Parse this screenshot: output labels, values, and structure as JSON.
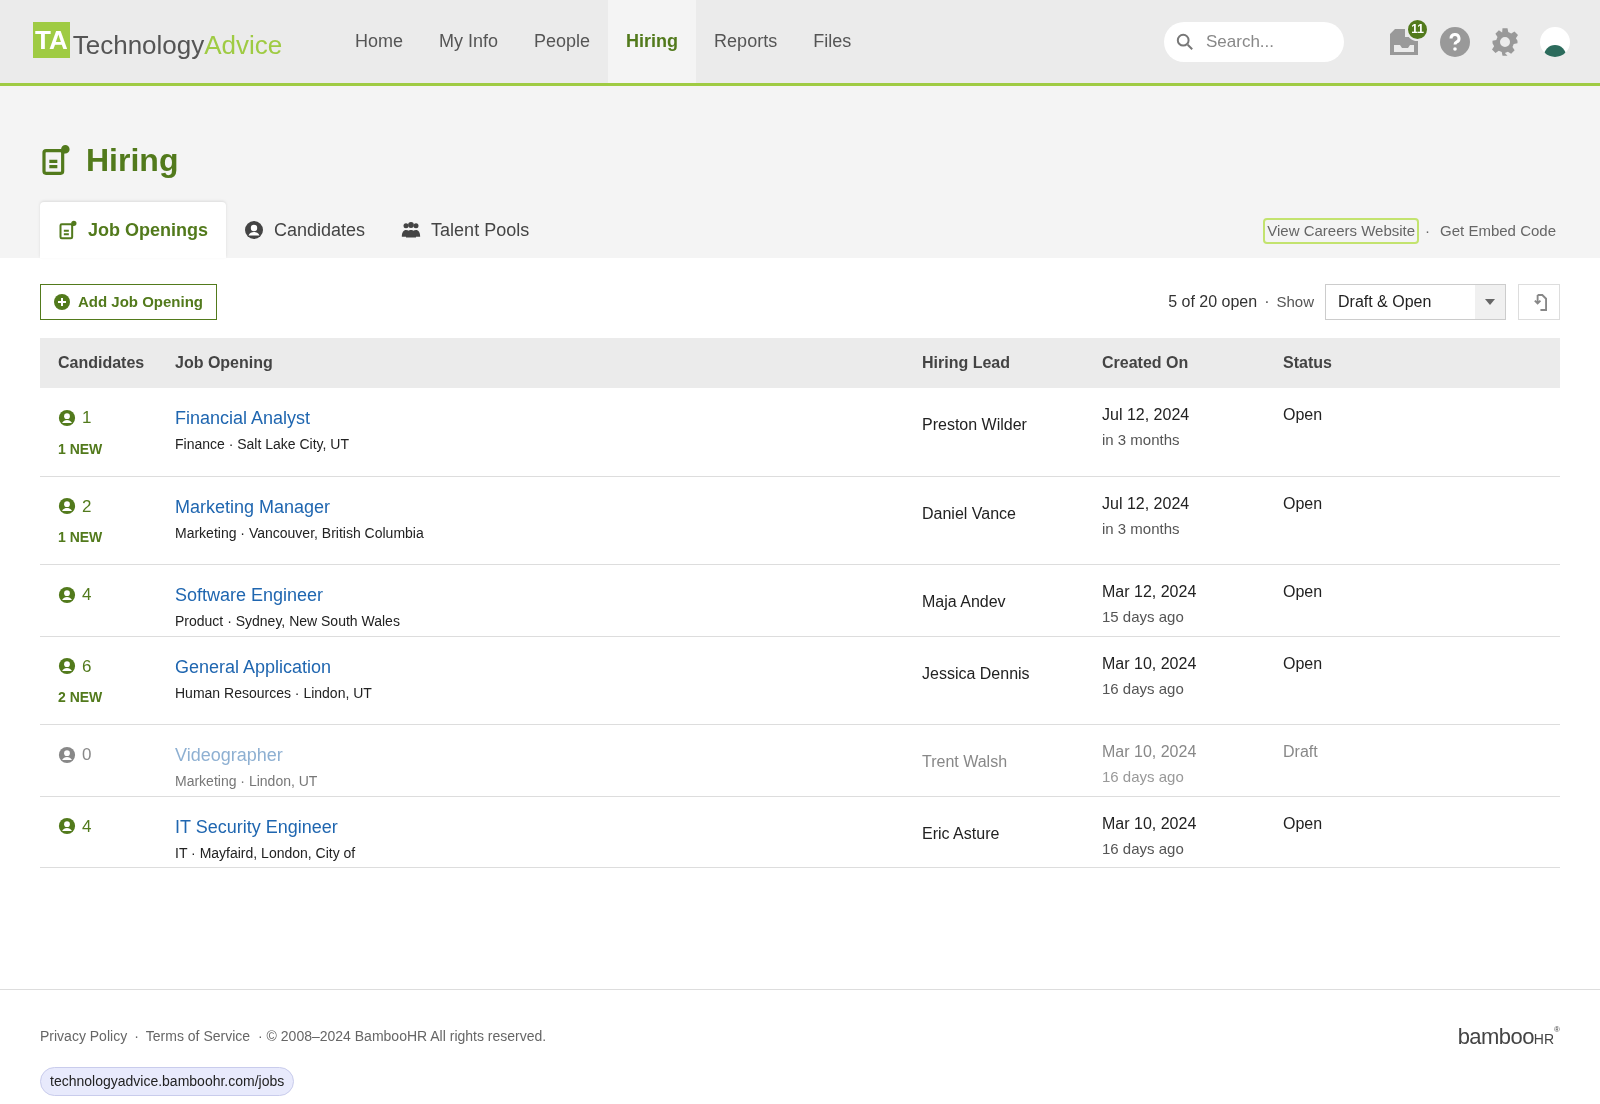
{
  "logo": {
    "mark": "TA",
    "word_1": "Technology",
    "word_2": "Advice"
  },
  "nav": [
    {
      "label": "Home",
      "selected": false
    },
    {
      "label": "My Info",
      "selected": false
    },
    {
      "label": "People",
      "selected": false
    },
    {
      "label": "Hiring",
      "selected": true
    },
    {
      "label": "Reports",
      "selected": false
    },
    {
      "label": "Files",
      "selected": false
    }
  ],
  "search": {
    "placeholder": "Search..."
  },
  "inbox_badge": "11",
  "page_title": "Hiring",
  "tabs": [
    {
      "label": "Job Openings",
      "selected": true,
      "kind": "openings"
    },
    {
      "label": "Candidates",
      "selected": false,
      "kind": "person"
    },
    {
      "label": "Talent Pools",
      "selected": false,
      "kind": "group"
    }
  ],
  "links": [
    "View Careers Website",
    "Get Embed Code"
  ],
  "separator": "·",
  "add_button": "Add Job Opening",
  "summary": "5 of 20 open",
  "show_label": "Show",
  "filter": "Draft & Open",
  "table": {
    "columns": [
      "Candidates",
      "Job Opening",
      "Hiring Lead",
      "Created On",
      "Status"
    ],
    "rows": [
      {
        "count": "1",
        "new": "1 NEW",
        "title": "Financial Analyst",
        "meta": "Finance · Salt Lake City, UT",
        "lead": "Preston Wilder",
        "date": "Jul 12, 2024",
        "relative": "in 3 months",
        "status": "Open",
        "draft": false
      },
      {
        "count": "2",
        "new": "1 NEW",
        "title": "Marketing Manager",
        "meta": "Marketing · Vancouver, British Columbia",
        "lead": "Daniel Vance",
        "date": "Jul 12, 2024",
        "relative": "in 3 months",
        "status": "Open",
        "draft": false
      },
      {
        "count": "4",
        "title": "Software Engineer",
        "meta": "Product · Sydney, New South Wales",
        "lead": "Maja Andev",
        "date": "Mar 12, 2024",
        "relative": "15 days ago",
        "status": "Open",
        "draft": false
      },
      {
        "count": "6",
        "new": "2 NEW",
        "title": "General Application",
        "meta": "Human Resources · Lindon, UT",
        "lead": "Jessica Dennis",
        "date": "Mar 10, 2024",
        "relative": "16 days ago",
        "status": "Open",
        "draft": false
      },
      {
        "count": "0",
        "title": "Videographer",
        "meta": "Marketing · Lindon, UT",
        "lead": "Trent Walsh",
        "date": "Mar 10, 2024",
        "relative": "16 days ago",
        "status": "Draft",
        "draft": true
      },
      {
        "count": "4",
        "title": "IT Security Engineer",
        "meta": "IT · Mayfaird, London, City of",
        "lead": "Eric Asture",
        "date": "Mar 10, 2024",
        "relative": "16 days ago",
        "status": "Open",
        "draft": false
      }
    ]
  },
  "footer": {
    "links": [
      "Privacy Policy",
      "Terms of Service"
    ],
    "copyright": "· © 2008–2024 BambooHR All rights reserved.",
    "brand": "bamboo",
    "brand_suffix": "HR",
    "brand_mark": "®"
  },
  "status_url": "technologyadvice.bamboohr.com/jobs"
}
